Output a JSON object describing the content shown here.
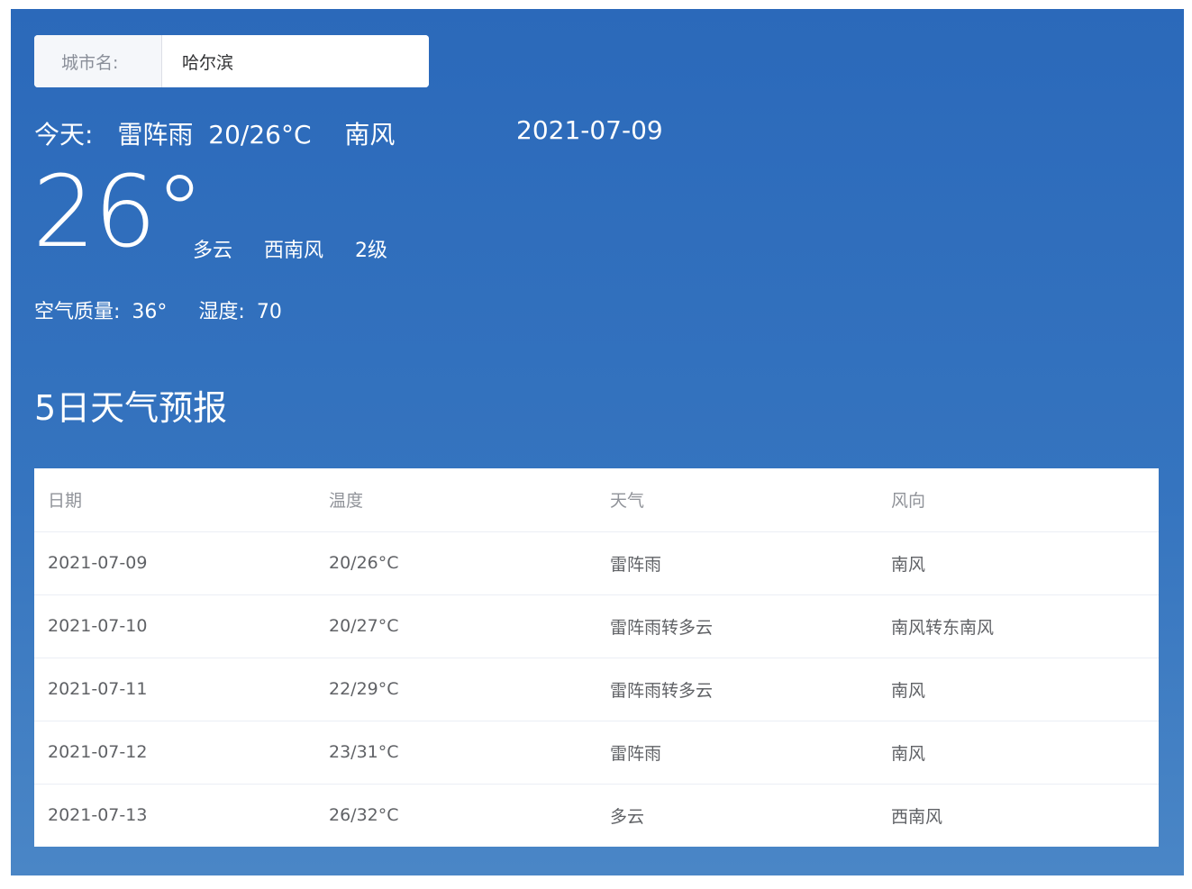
{
  "search": {
    "prefix": "城市名:",
    "value": "哈尔滨"
  },
  "today": {
    "label": "今天:",
    "weather": "雷阵雨",
    "temp_range": "20/26°C",
    "wind": "南风",
    "date": "2021-07-09"
  },
  "now": {
    "temp": "26°",
    "weather": "多云",
    "wind_dir": "西南风",
    "wind_level": "2级"
  },
  "air": {
    "quality_label": "空气质量:",
    "quality_value": "36°",
    "humidity_label": "湿度:",
    "humidity_value": "70"
  },
  "forecast": {
    "title": "5日天气预报",
    "headers": [
      "日期",
      "温度",
      "天气",
      "风向"
    ],
    "rows": [
      [
        "2021-07-09",
        "20/26°C",
        "雷阵雨",
        "南风"
      ],
      [
        "2021-07-10",
        "20/27°C",
        "雷阵雨转多云",
        "南风转东南风"
      ],
      [
        "2021-07-11",
        "22/29°C",
        "雷阵雨转多云",
        "南风"
      ],
      [
        "2021-07-12",
        "23/31°C",
        "雷阵雨",
        "南风"
      ],
      [
        "2021-07-13",
        "26/32°C",
        "多云",
        "西南风"
      ]
    ]
  }
}
